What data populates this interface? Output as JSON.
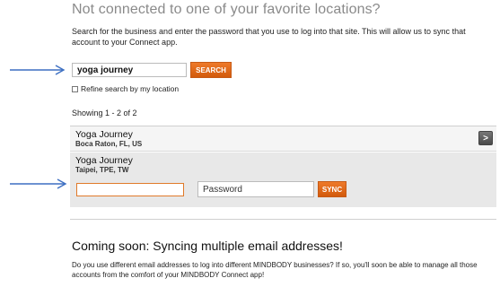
{
  "page": {
    "heading": "Not connected to one of your favorite locations?",
    "intro": "Search for the business and enter the password that you use to log into that site. This will allow us to sync that account to your Connect app."
  },
  "search": {
    "value": "yoga journey",
    "button_label": "SEARCH",
    "refine_label": "Refine search by my location"
  },
  "results": {
    "showing": "Showing 1 - 2 of 2",
    "items": [
      {
        "name": "Yoga Journey",
        "location": "Boca Raton, FL, US",
        "action_icon": "chevron-right-icon",
        "action_glyph": ">"
      },
      {
        "name": "Yoga Journey",
        "location": "Taipei, TPE, TW"
      }
    ],
    "password_placeholder": "Password",
    "sync_label": "SYNC"
  },
  "coming_soon": {
    "title": "Coming soon: Syncing multiple email addresses!",
    "text": "Do you use different email addresses to log into different MINDBODY businesses? If so, you'll soon be able to manage all those accounts from the comfort of your MINDBODY Connect app!"
  },
  "colors": {
    "accent_orange": "#e06a1a",
    "arrow_blue": "#3d6fc2"
  }
}
